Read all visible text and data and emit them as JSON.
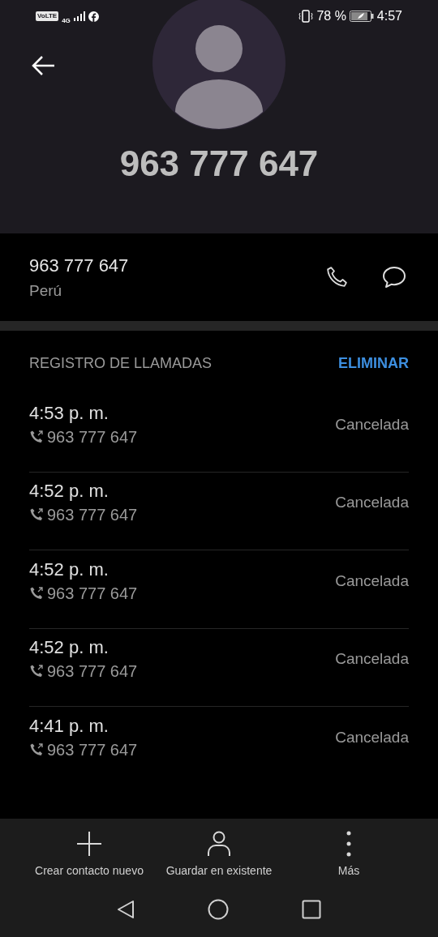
{
  "status_bar": {
    "volte": "VoLTE",
    "network": "4G",
    "battery": "78 %",
    "time": "4:57"
  },
  "header": {
    "title": "963 777 647"
  },
  "contact": {
    "number": "963 777 647",
    "country": "Perú"
  },
  "call_log": {
    "title": "REGISTRO DE LLAMADAS",
    "action": "ELIMINAR",
    "rows": [
      {
        "time": "4:53 p. m.",
        "number": "963 777 647",
        "status": "Cancelada"
      },
      {
        "time": "4:52 p. m.",
        "number": "963 777 647",
        "status": "Cancelada"
      },
      {
        "time": "4:52 p. m.",
        "number": "963 777 647",
        "status": "Cancelada"
      },
      {
        "time": "4:52 p. m.",
        "number": "963 777 647",
        "status": "Cancelada"
      },
      {
        "time": "4:41 p. m.",
        "number": "963 777 647",
        "status": "Cancelada"
      }
    ]
  },
  "actions": [
    {
      "kind": "add",
      "label": "Crear contacto nuevo"
    },
    {
      "kind": "person",
      "label": "Guardar en existente"
    },
    {
      "kind": "more",
      "label": "Más"
    }
  ]
}
